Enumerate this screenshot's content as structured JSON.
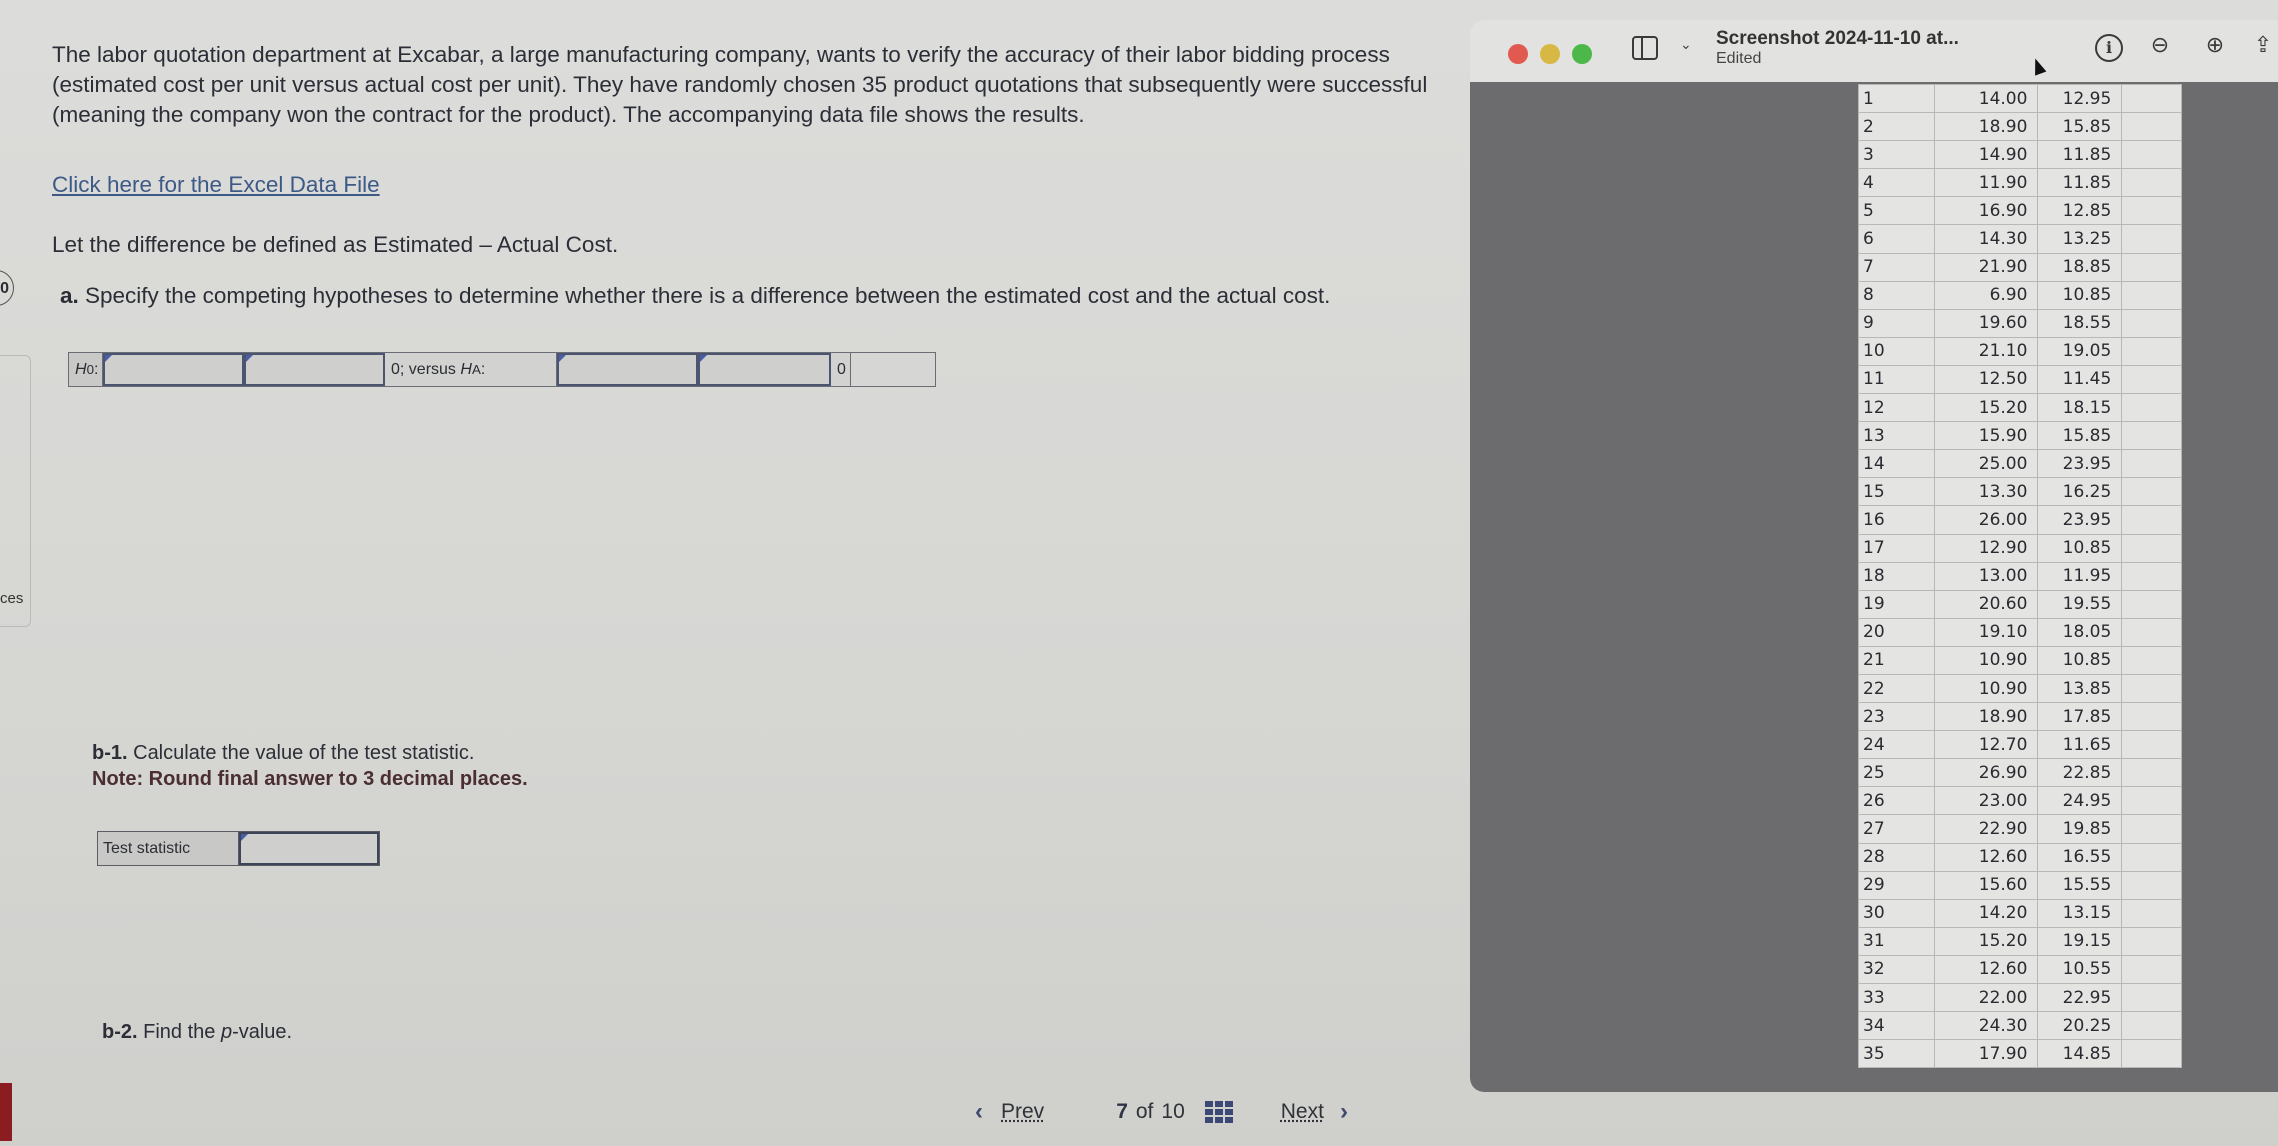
{
  "question": {
    "intro": "The labor quotation department at Excabar, a large manufacturing company, wants to verify the accuracy of their labor bidding process (estimated cost per unit versus actual cost per unit). They have randomly chosen 35 product quotations that subsequently were successful (meaning the company won the contract for the product). The accompanying data file shows the results.",
    "data_link": "Click here for the Excel Data File",
    "definition": "Let the difference be defined as Estimated – Actual Cost.",
    "part_a_label": "a.",
    "part_a_text": " Specify the competing hypotheses to determine whether there is a difference between the estimated cost and the actual cost.",
    "hypotheses": {
      "h0_label": "H",
      "h0_sub": "0",
      "h0_select1": "",
      "h0_select2": "",
      "middle_text": "0; versus ",
      "ha_label": "H",
      "ha_sub": "A",
      "ha_select1": "",
      "ha_select2": "",
      "end_value": "0"
    },
    "part_b1_label": "b-1.",
    "part_b1_text": " Calculate the value of the test statistic.",
    "part_b1_note": "Note: Round final answer to 3 decimal places.",
    "test_statistic_label": "Test statistic",
    "test_statistic_value": "",
    "part_b2_label": "b-2.",
    "part_b2_text_pre": " Find the ",
    "part_b2_italic": "p",
    "part_b2_text_post": "-value."
  },
  "side": {
    "badge": "0",
    "label": "ces"
  },
  "navigation": {
    "prev": "Prev",
    "current": "7",
    "of": "of",
    "total": "10",
    "next": "Next"
  },
  "preview_window": {
    "title": "Screenshot 2024-11-10 at...",
    "subtitle": "Edited",
    "traffic_light_colors": [
      "#e05a4f",
      "#d8b845",
      "#4cb84a"
    ],
    "toolbar_icons": [
      "sidebar-icon",
      "chevron-down-icon",
      "info-icon",
      "zoom-out-icon",
      "zoom-in-icon",
      "share-icon"
    ]
  },
  "spreadsheet": {
    "rows": [
      [
        "1",
        "14.00",
        "12.95"
      ],
      [
        "2",
        "18.90",
        "15.85"
      ],
      [
        "3",
        "14.90",
        "11.85"
      ],
      [
        "4",
        "11.90",
        "11.85"
      ],
      [
        "5",
        "16.90",
        "12.85"
      ],
      [
        "6",
        "14.30",
        "13.25"
      ],
      [
        "7",
        "21.90",
        "18.85"
      ],
      [
        "8",
        "6.90",
        "10.85"
      ],
      [
        "9",
        "19.60",
        "18.55"
      ],
      [
        "10",
        "21.10",
        "19.05"
      ],
      [
        "11",
        "12.50",
        "11.45"
      ],
      [
        "12",
        "15.20",
        "18.15"
      ],
      [
        "13",
        "15.90",
        "15.85"
      ],
      [
        "14",
        "25.00",
        "23.95"
      ],
      [
        "15",
        "13.30",
        "16.25"
      ],
      [
        "16",
        "26.00",
        "23.95"
      ],
      [
        "17",
        "12.90",
        "10.85"
      ],
      [
        "18",
        "13.00",
        "11.95"
      ],
      [
        "19",
        "20.60",
        "19.55"
      ],
      [
        "20",
        "19.10",
        "18.05"
      ],
      [
        "21",
        "10.90",
        "10.85"
      ],
      [
        "22",
        "10.90",
        "13.85"
      ],
      [
        "23",
        "18.90",
        "17.85"
      ],
      [
        "24",
        "12.70",
        "11.65"
      ],
      [
        "25",
        "26.90",
        "22.85"
      ],
      [
        "26",
        "23.00",
        "24.95"
      ],
      [
        "27",
        "22.90",
        "19.85"
      ],
      [
        "28",
        "12.60",
        "16.55"
      ],
      [
        "29",
        "15.60",
        "15.55"
      ],
      [
        "30",
        "14.20",
        "13.15"
      ],
      [
        "31",
        "15.20",
        "19.15"
      ],
      [
        "32",
        "12.60",
        "10.55"
      ],
      [
        "33",
        "22.00",
        "22.95"
      ],
      [
        "34",
        "24.30",
        "20.25"
      ],
      [
        "35",
        "17.90",
        "14.85"
      ]
    ]
  }
}
